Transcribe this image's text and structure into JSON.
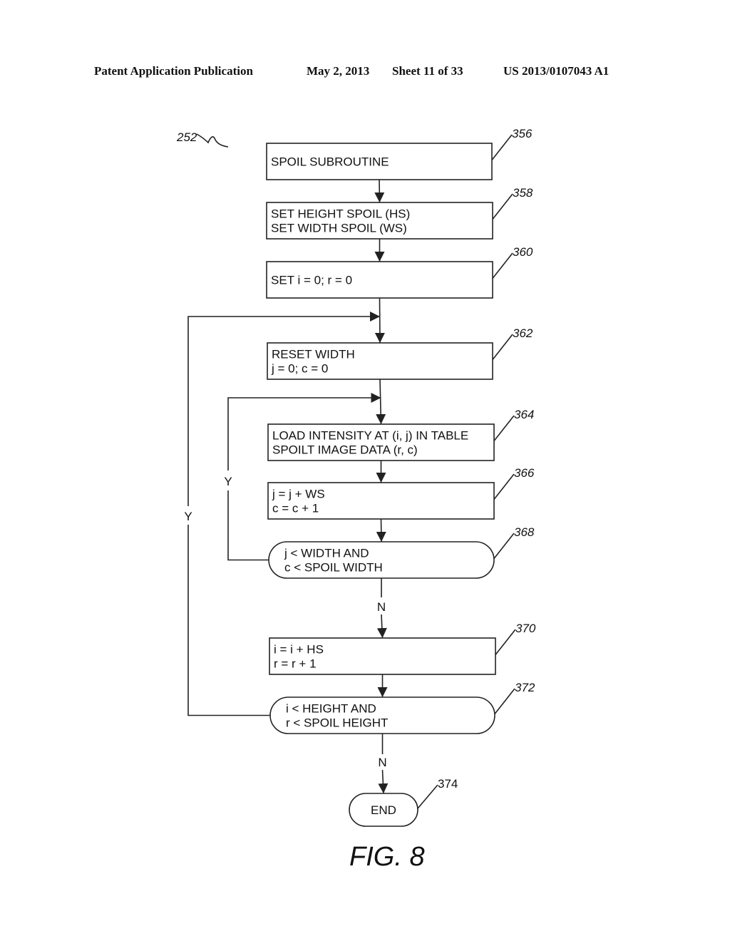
{
  "header": {
    "publication": "Patent Application Publication",
    "date": "May 2, 2013",
    "sheet": "Sheet 11 of 33",
    "number": "US 2013/0107043 A1"
  },
  "diagram": {
    "ref": "252",
    "figure_label": "FIG. 8",
    "nodes": [
      {
        "id": "356",
        "type": "process",
        "lines": [
          "SPOIL SUBROUTINE"
        ]
      },
      {
        "id": "358",
        "type": "process",
        "lines": [
          "SET HEIGHT SPOIL (HS)",
          "SET WIDTH SPOIL (WS)"
        ]
      },
      {
        "id": "360",
        "type": "process",
        "lines": [
          "SET  i = 0;  r = 0"
        ]
      },
      {
        "id": "362",
        "type": "process",
        "lines": [
          "RESET WIDTH",
          "j = 0;  c = 0"
        ]
      },
      {
        "id": "364",
        "type": "process",
        "lines": [
          "LOAD INTENSITY AT (i, j) IN TABLE",
          "SPOILT IMAGE DATA (r, c)"
        ]
      },
      {
        "id": "366",
        "type": "process",
        "lines": [
          "j = j + WS",
          "c = c + 1"
        ]
      },
      {
        "id": "368",
        "type": "decision",
        "lines": [
          "j < WIDTH AND",
          "c < SPOIL WIDTH"
        ]
      },
      {
        "id": "370",
        "type": "process",
        "lines": [
          "i = i + HS",
          "r = r + 1"
        ]
      },
      {
        "id": "372",
        "type": "decision",
        "lines": [
          "i < HEIGHT AND",
          "r < SPOIL HEIGHT"
        ]
      },
      {
        "id": "374",
        "type": "terminal",
        "lines": [
          "END"
        ]
      }
    ],
    "edges": [
      {
        "from": "356",
        "to": "358",
        "label": ""
      },
      {
        "from": "358",
        "to": "360",
        "label": ""
      },
      {
        "from": "360",
        "to": "362",
        "label": ""
      },
      {
        "from": "362",
        "to": "364",
        "label": ""
      },
      {
        "from": "364",
        "to": "366",
        "label": ""
      },
      {
        "from": "366",
        "to": "368",
        "label": ""
      },
      {
        "from": "368",
        "to": "364",
        "label": "Y"
      },
      {
        "from": "368",
        "to": "370",
        "label": "N"
      },
      {
        "from": "370",
        "to": "372",
        "label": ""
      },
      {
        "from": "372",
        "to": "362",
        "label": "Y"
      },
      {
        "from": "372",
        "to": "374",
        "label": "N"
      }
    ]
  }
}
